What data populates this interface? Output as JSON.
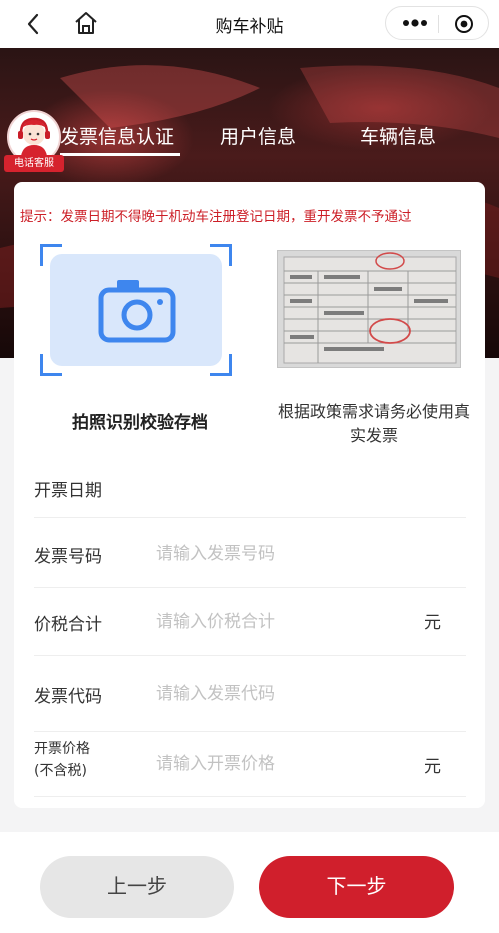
{
  "navbar": {
    "title": "购车补贴",
    "icons": [
      "back-icon",
      "home-icon",
      "more-icon",
      "close-icon"
    ]
  },
  "service": {
    "label": "电话客服"
  },
  "tabs": [
    {
      "label": "发票信息认证",
      "active": true
    },
    {
      "label": "用户信息",
      "active": false
    },
    {
      "label": "车辆信息",
      "active": false
    }
  ],
  "notice": "提示：发票日期不得晚于机动车注册登记日期，重开发票不予通过",
  "upload": {
    "left_caption": "拍照识别校验存档",
    "right_caption": "根据政策需求请务必使用真实发票"
  },
  "form": {
    "date_label": "开票日期",
    "invoice_no_label": "发票号码",
    "invoice_no_placeholder": "请输入发票号码",
    "total_label": "价税合计",
    "total_placeholder": "请输入价税合计",
    "total_unit": "元",
    "code_label": "发票代码",
    "code_placeholder": "请输入发票代码",
    "price_label_line1": "开票价格",
    "price_label_line2": "(不含税)",
    "price_placeholder": "请输入开票价格",
    "price_unit": "元"
  },
  "buttons": {
    "prev": "上一步",
    "next": "下一步"
  },
  "colors": {
    "accent": "#d01f2c",
    "notice": "#cc1f27",
    "camera": "#3e86ee"
  }
}
